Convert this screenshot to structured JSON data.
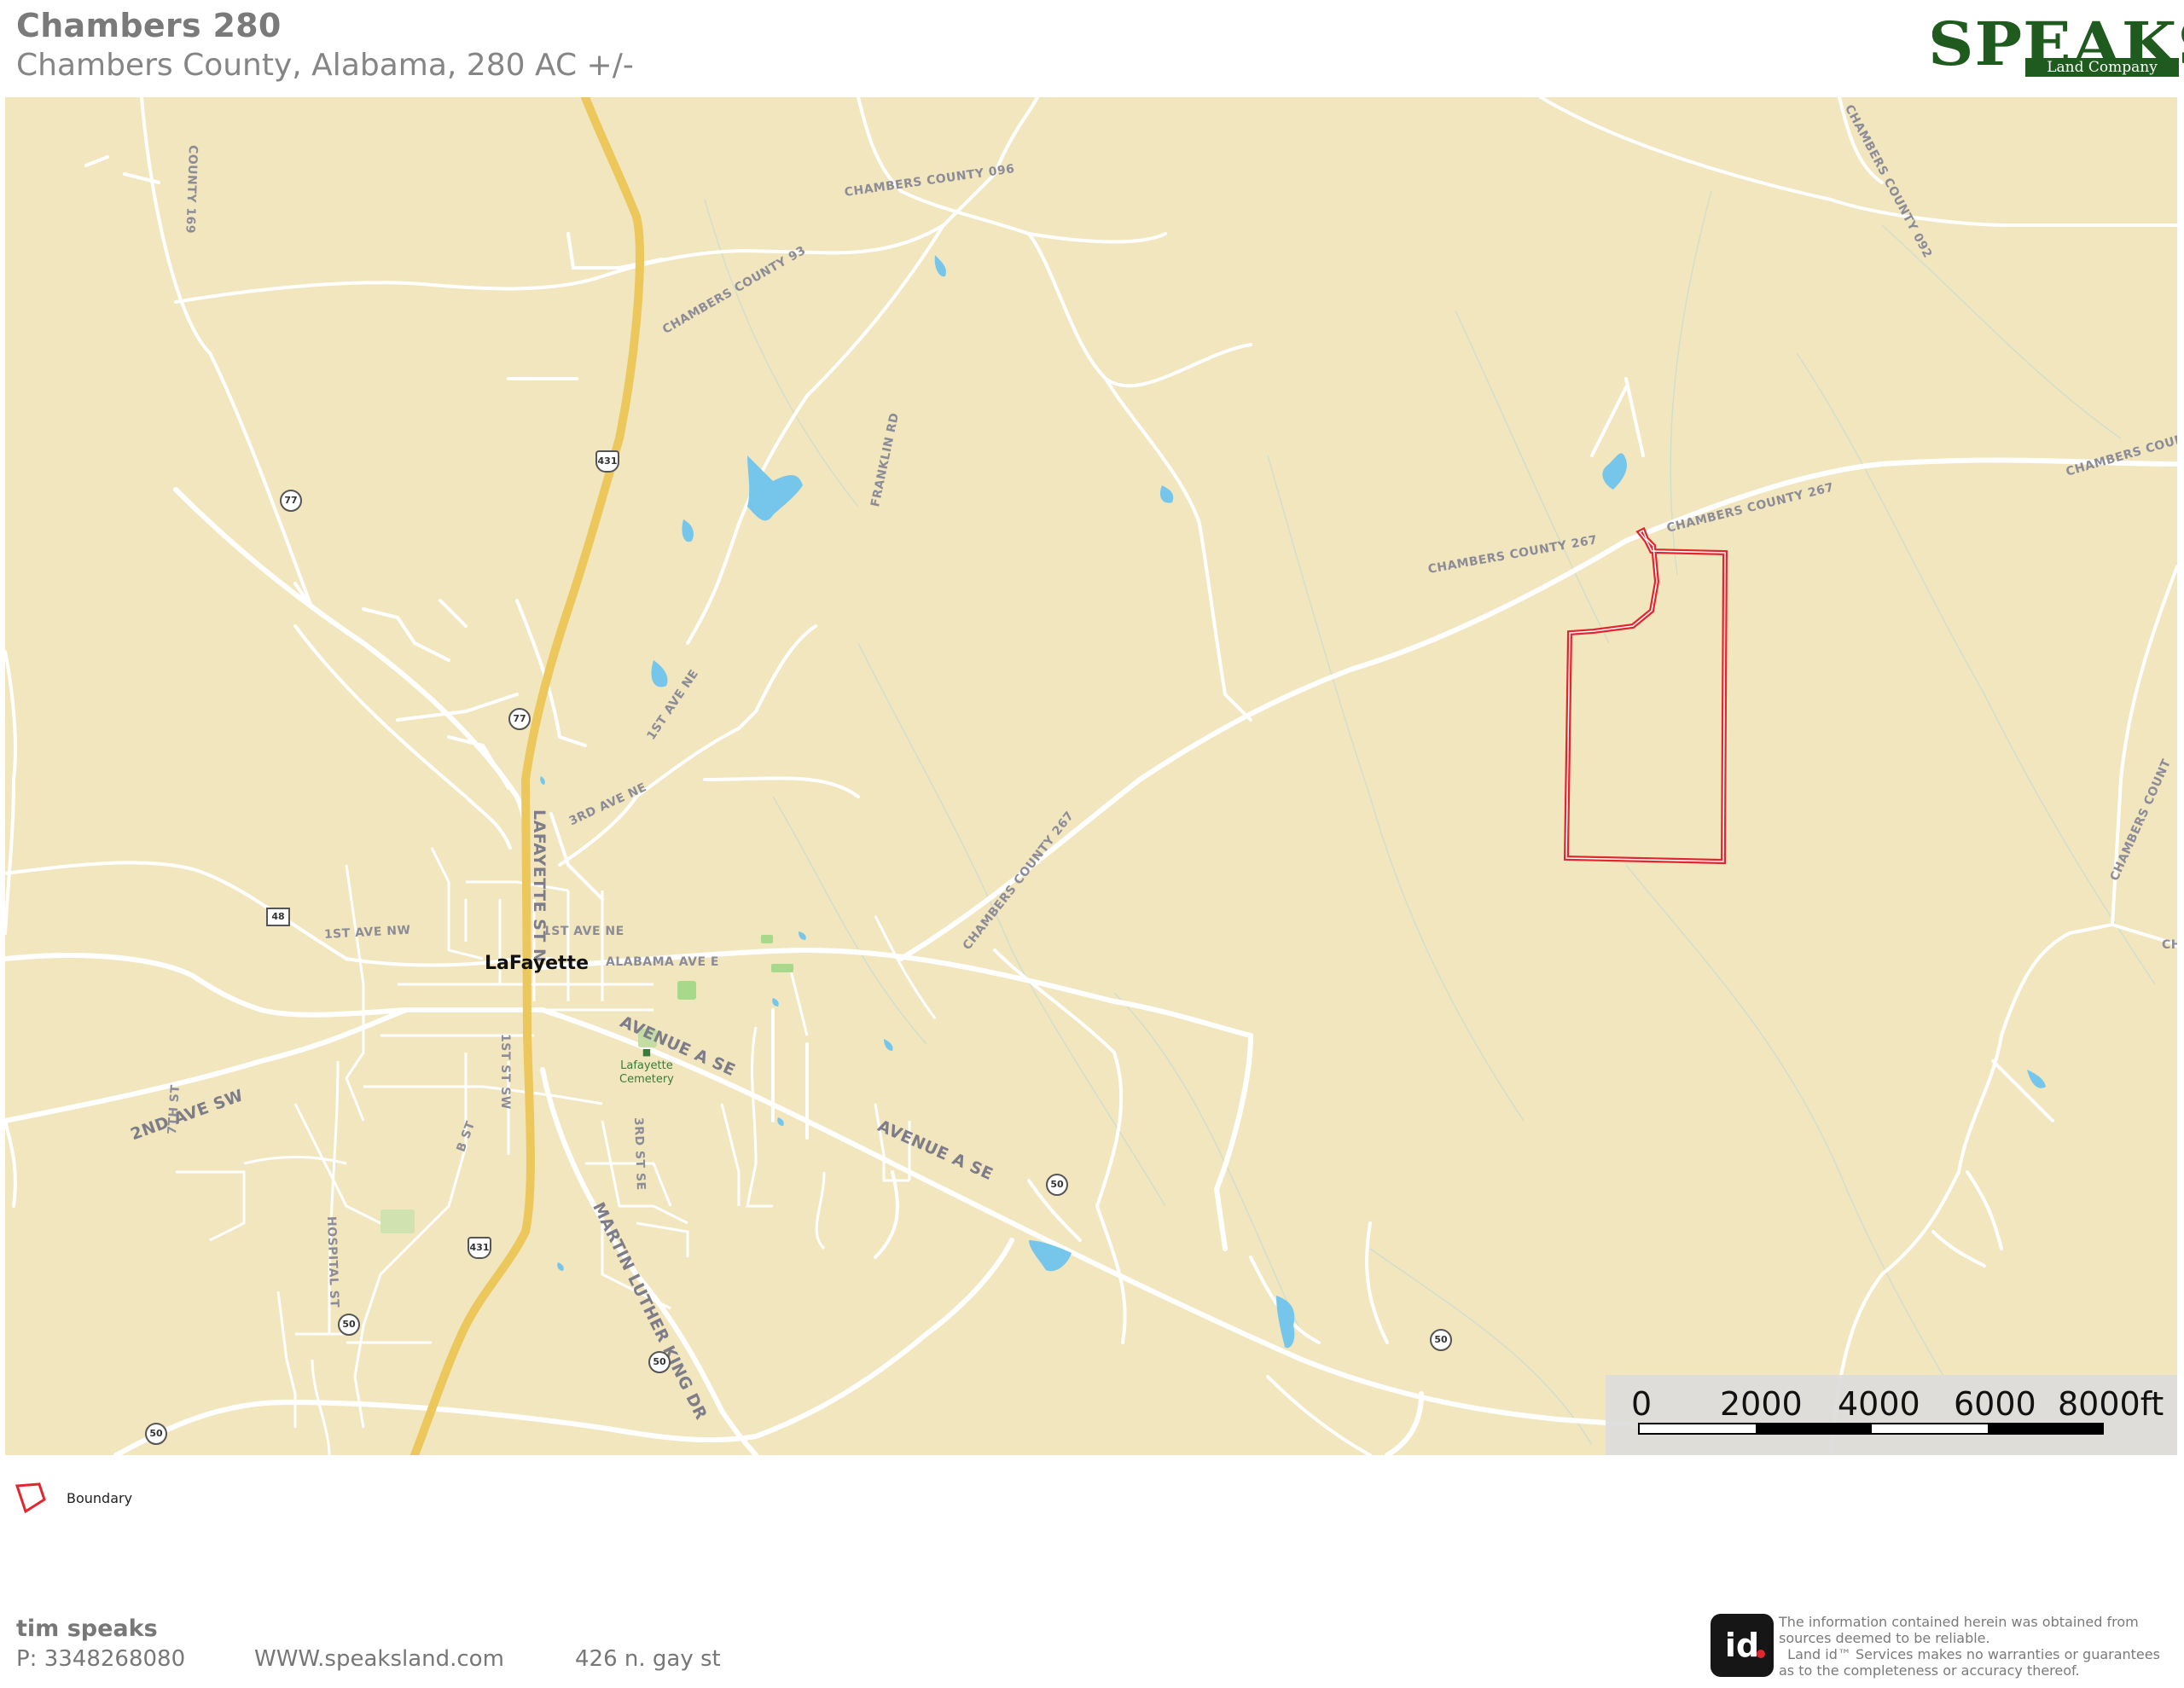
{
  "header": {
    "title": "Chambers 280",
    "subtitle": "Chambers County, Alabama, 280 AC +/-"
  },
  "logo": {
    "word": "SPEAKS",
    "tagline": "Land Company",
    "color": "#1f5a1f"
  },
  "map": {
    "background_color": "#f2e6bf",
    "road_color": "#ffffff",
    "highway_color": "#ecc85c",
    "water_color": "#76c6ec",
    "boundary_color": "#e3262e",
    "town": "LaFayette",
    "poi": {
      "line1": "Lafayette",
      "line2": "Cemetery"
    },
    "road_labels": [
      "COUNTY 169",
      "CHAMBERS COUNTY 096",
      "CHAMBERS COUNTY 93",
      "FRANKLIN RD",
      "1ST AVE NE",
      "3RD AVE NE",
      "LAFAYETTE ST N",
      "1ST AVE NW",
      "1ST AVE NE",
      "ALABAMA AVE E",
      "AVENUE A SE",
      "AVENUE A SE",
      "1ST ST SW",
      "2ND AVE SW",
      "7TH ST",
      "B ST",
      "3RD ST SE",
      "HOSPITAL ST",
      "MARTIN LUTHER KING DR",
      "CHAMBERS COUNTY 267",
      "CHAMBERS COUNTY 267",
      "CHAMBERS COUNTY 267",
      "CHAMBERS COUNTY 092",
      "CHAMBERS COUNTY",
      "CHAMBERS COUNT",
      "CH"
    ],
    "shields": {
      "us431": "431",
      "sr77": "77",
      "sr50": "50",
      "cr48": "48"
    }
  },
  "scale": {
    "labels": [
      "0",
      "2000",
      "4000",
      "6000",
      "8000ft"
    ]
  },
  "legend": {
    "boundary_label": "Boundary"
  },
  "contact": {
    "name": "tim speaks",
    "phone": "P: 3348268080",
    "website": "WWW.speaksland.com",
    "address": "426 n. gay st"
  },
  "id_logo": "id",
  "disclaimer": "The information contained herein was obtained from sources deemed to be reliable.\n  Land id™ Services makes no warranties or guarantees as to the completeness or accuracy thereof."
}
